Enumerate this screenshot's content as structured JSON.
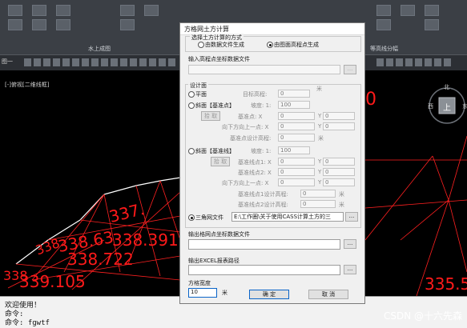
{
  "cad": {
    "ribbon_panel_label": "水上成图",
    "ribbon_panel_label_right": "等高线分幅",
    "tab_label": "图一",
    "viewport_label": "[-]俯视[二维线框]",
    "labels_big": [
      "337.",
      "338.63",
      "338.391",
      "338.722",
      "339.105",
      "335.5"
    ],
    "labels_extra": [
      "338.",
      "338"
    ],
    "nav_cube_label": "上",
    "compass": {
      "north": "北",
      "west": "西",
      "east": "东"
    }
  },
  "command": {
    "line1": "欢迎使用！",
    "line2": "命令:",
    "line3": "命令: fgwtf"
  },
  "watermark": "CSDN @十六先森",
  "dialog": {
    "title": "方格网土方计算",
    "method": {
      "group_label": "选择土方计算的方式",
      "option_file": "由数据文件生成",
      "option_surface": "由图面高程点生成",
      "selected": "option_surface"
    },
    "input_file": {
      "label": "输入高程点坐标数据文件",
      "value": "",
      "browse": "..."
    },
    "design": {
      "group_label": "设计面",
      "plane": {
        "label": "平面",
        "target_label": "目标高程:",
        "target_value": "0",
        "target_unit": "米"
      },
      "slope_point": {
        "label": "斜面【基准点】",
        "slope_label": "坡度: 1:",
        "slope_value": "100",
        "pick": "拾 取",
        "base_point_label": "基准点: X",
        "base_x": "0",
        "y_label": "Y",
        "base_y": "0",
        "down_point_label": "向下方向上一点: X",
        "down_x": "0",
        "down_y": "0",
        "elev_label": "基准点设计高程:",
        "elev_value": "0",
        "elev_unit": "米"
      },
      "slope_line": {
        "label": "斜面【基准线】",
        "slope_label": "坡度: 1:",
        "slope_value": "100",
        "pick": "拾 取",
        "p1_label": "基准线点1: X",
        "p1_x": "0",
        "y_label": "Y",
        "p1_y": "0",
        "p2_label": "基准线点2: X",
        "p2_x": "0",
        "p2_y": "0",
        "down_label": "向下方向上一点: X",
        "down_x": "0",
        "down_y": "0",
        "elev1_label": "基准线点1设计高程:",
        "elev1_value": "0",
        "elev2_label": "基准线点2设计高程:",
        "elev2_value": "0",
        "unit": "米"
      },
      "tin": {
        "label": "三角网文件",
        "value": "E:\\工作圈\\关于使用CASS计算土方的三",
        "browse": "...",
        "selected": true
      }
    },
    "output_grid": {
      "label": "输出格网点坐标数据文件",
      "value": "",
      "browse": "..."
    },
    "output_excel": {
      "label": "输出EXCEL报表路径",
      "value": "",
      "browse": "..."
    },
    "grid_width": {
      "label": "方格宽度",
      "value": "10",
      "unit": "米"
    },
    "ok": "确  定",
    "cancel": "取  消"
  }
}
